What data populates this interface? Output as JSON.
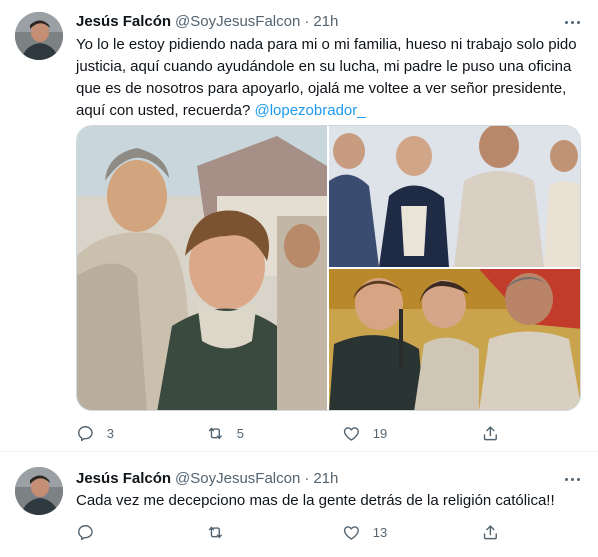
{
  "tweets": [
    {
      "author_name": "Jesús Falcón",
      "handle": "@SoyJesusFalcon",
      "separator": "·",
      "time": "21h",
      "text_before_mention": "Yo lo le estoy pidiendo nada para mi o mi familia, hueso ni trabajo solo pido justicia, aquí cuando ayudándole en su lucha, mi padre le puso una oficina que es de nosotros para apoyarlo, ojalá me voltee a ver señor presidente, aquí con usted, recuerda? ",
      "mention": "@lopezobrador_",
      "photos": [
        "photo of a man and a boy in a crowd",
        "photo of a boy speaking into a microphone next to a man",
        "photo of a boy in charro jacket speaking at a microphone with a woman and a man"
      ],
      "actions": {
        "reply_count": "3",
        "retweet_count": "5",
        "like_count": "19",
        "reply_icon": "reply-icon",
        "retweet_icon": "retweet-icon",
        "like_icon": "like-icon",
        "share_icon": "share-icon"
      }
    },
    {
      "author_name": "Jesús Falcón",
      "handle": "@SoyJesusFalcon",
      "separator": "·",
      "time": "21h",
      "text": "Cada vez me decepciono mas de la gente detrás de la religión católica!!",
      "actions": {
        "reply_count": "",
        "retweet_count": "",
        "like_count": "13",
        "reply_icon": "reply-icon",
        "retweet_icon": "retweet-icon",
        "like_icon": "like-icon",
        "share_icon": "share-icon"
      }
    }
  ],
  "colors": {
    "text": "#0f1419",
    "secondary": "#536471",
    "link": "#1d9bf0",
    "divider": "#eff3f4"
  }
}
